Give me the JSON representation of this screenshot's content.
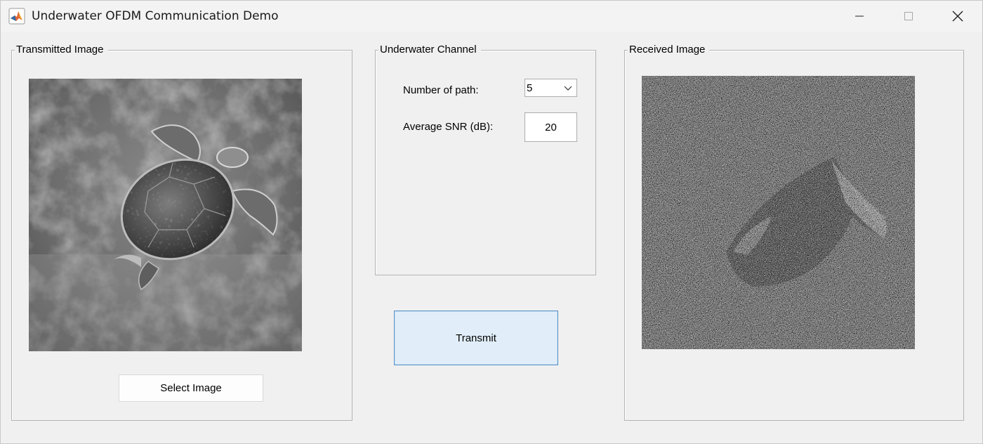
{
  "window": {
    "title": "Underwater OFDM Communication Demo",
    "icon": "matlab-logo-icon"
  },
  "left_panel": {
    "title": "Transmitted Image",
    "select_button_label": "Select Image"
  },
  "channel_panel": {
    "title": "Underwater Channel",
    "paths_label": "Number of path:",
    "paths_value": "5",
    "snr_label": "Average SNR (dB):",
    "snr_value": "20"
  },
  "transmit_button_label": "Transmit",
  "right_panel": {
    "title": "Received Image"
  },
  "colors": {
    "window_bg": "#f0f0f0",
    "transmit_bg": "#e1eef9",
    "transmit_border": "#5b94c9"
  }
}
